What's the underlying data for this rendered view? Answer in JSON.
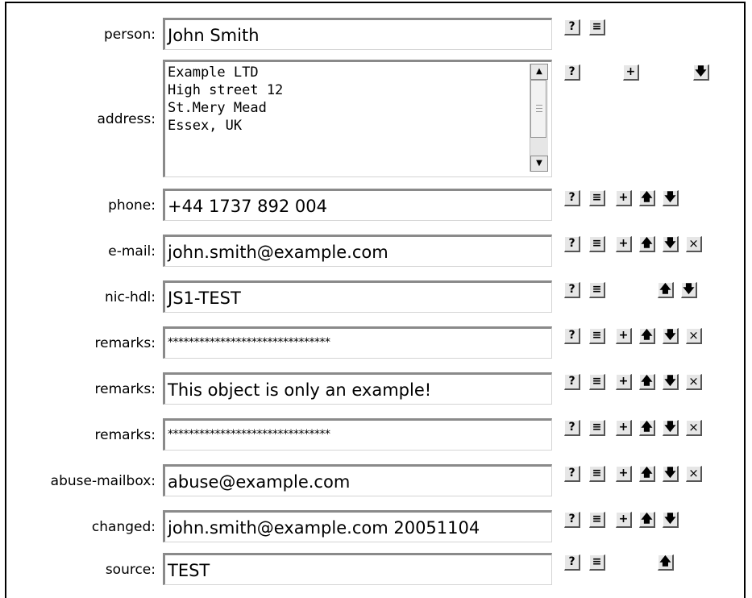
{
  "fields": [
    {
      "label": "person:",
      "value": "John Smith"
    },
    {
      "label": "address:",
      "value": "Example LTD\nHigh street 12\nSt.Mery Mead\nEssex, UK"
    },
    {
      "label": "phone:",
      "value": "+44 1737 892 004"
    },
    {
      "label": "e-mail:",
      "value": "john.smith@example.com"
    },
    {
      "label": "nic-hdl:",
      "value": "JS1-TEST"
    },
    {
      "label": "remarks:",
      "value": "*******************************"
    },
    {
      "label": "remarks:",
      "value": "This object is only an example!"
    },
    {
      "label": "remarks:",
      "value": "*******************************"
    },
    {
      "label": "abuse-mailbox:",
      "value": "abuse@example.com"
    },
    {
      "label": "changed:",
      "value": "john.smith@example.com 20051104"
    },
    {
      "label": "source:",
      "value": "TEST"
    }
  ],
  "button_glyphs": {
    "help": "?",
    "list": "≡",
    "add": "+",
    "up": "🡅",
    "down": "🡇",
    "delete": "×",
    "scroll_up": "▲",
    "scroll_down": "▼"
  },
  "icons": {
    "help": "help-icon",
    "list": "list-icon",
    "add": "add-icon",
    "up": "arrow-up-icon",
    "down": "arrow-down-icon",
    "delete": "close-icon"
  }
}
